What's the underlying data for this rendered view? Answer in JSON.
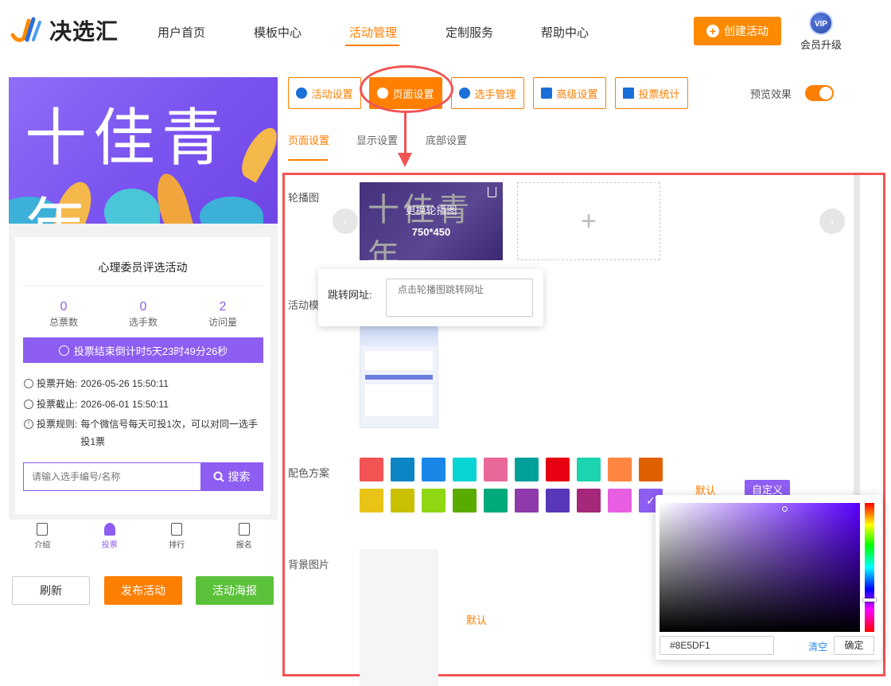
{
  "header": {
    "logo_text": "决选汇",
    "nav": [
      "用户首页",
      "模板中心",
      "活动管理",
      "定制服务",
      "帮助中心"
    ],
    "create_button": "创建活动",
    "vip_badge": "VIP",
    "vip_label": "会员升级"
  },
  "preview": {
    "banner_text": "十佳青年",
    "activity_title": "心理委员评选活动",
    "stats": [
      {
        "num": "0",
        "label": "总票数"
      },
      {
        "num": "0",
        "label": "选手数"
      },
      {
        "num": "2",
        "label": "访问量"
      }
    ],
    "countdown": "投票结束倒计时5天23时49分26秒",
    "start_label": "投票开始:",
    "start_value": "2026-05-26 15:50:11",
    "end_label": "投票截止:",
    "end_value": "2026-06-01 15:50:11",
    "rule_label": "投票规则:",
    "rule_value": "每个微信号每天可投1次，可以对同一选手投1票",
    "search_placeholder": "请输入选手编号/名称",
    "search_button": "搜索",
    "tabbar": [
      "介绍",
      "投票",
      "排行",
      "报名"
    ],
    "buttons": {
      "refresh": "刷新",
      "publish": "发布活动",
      "poster": "活动海报"
    }
  },
  "toolbar": {
    "buttons": [
      "活动设置",
      "页面设置",
      "选手管理",
      "高级设置",
      "投票统计"
    ],
    "preview_label": "预览效果"
  },
  "subtabs": [
    "页面设置",
    "显示设置",
    "底部设置"
  ],
  "form": {
    "carousel_label": "轮播图",
    "carousel_replace": "更换轮播图",
    "carousel_size": "750*450",
    "add_symbol": "+",
    "link_label": "跳转网址:",
    "link_placeholder": "点击轮播图跳转网址",
    "template_label": "活动模",
    "color_label": "配色方案",
    "color_default": "默认",
    "color_custom": "自定义",
    "bg_label": "背景图片",
    "bg_default": "默认"
  },
  "colors": {
    "accent": "#ff7f00",
    "theme": "#8E5DF1",
    "row1": [
      "#f25454",
      "#0b85c4",
      "#1a87e8",
      "#08d4d4",
      "#e8689a",
      "#00a09a",
      "#e60012",
      "#1cd4b0",
      "#ff8540",
      "#e06000"
    ],
    "row2": [
      "#e8c416",
      "#c8c000",
      "#8fd613",
      "#5aab00",
      "#00aa7a",
      "#8e3aab",
      "#5838b8",
      "#a6287a",
      "#e75ee0",
      "#8E5DF1"
    ]
  },
  "picker": {
    "hex": "#8E5DF1",
    "clear": "清空",
    "confirm": "确定"
  }
}
